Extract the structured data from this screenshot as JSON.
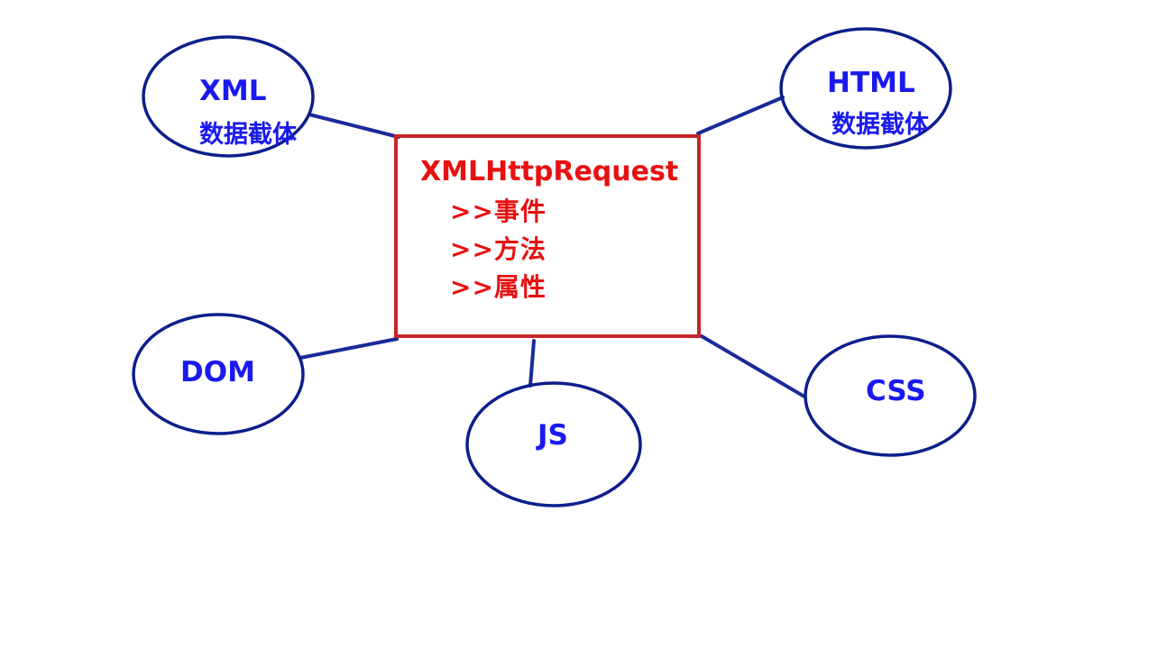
{
  "colors": {
    "ellipse_stroke": "#0d1f8c",
    "connector": "#1a2a9a",
    "box_stroke": "#c8232a",
    "node_text": "#1a1aee",
    "center_text": "#e81010",
    "background": "#ffffff"
  },
  "center": {
    "title": "XMLHttpRequest",
    "items": [
      ">>事件",
      ">>方法",
      ">>属性"
    ]
  },
  "nodes": {
    "xml": {
      "label": "XML",
      "sublabel": "数据截体"
    },
    "html": {
      "label": "HTML",
      "sublabel": "数据截体"
    },
    "dom": {
      "label": "DOM"
    },
    "js": {
      "label": "JS"
    },
    "css": {
      "label": "CSS"
    }
  }
}
